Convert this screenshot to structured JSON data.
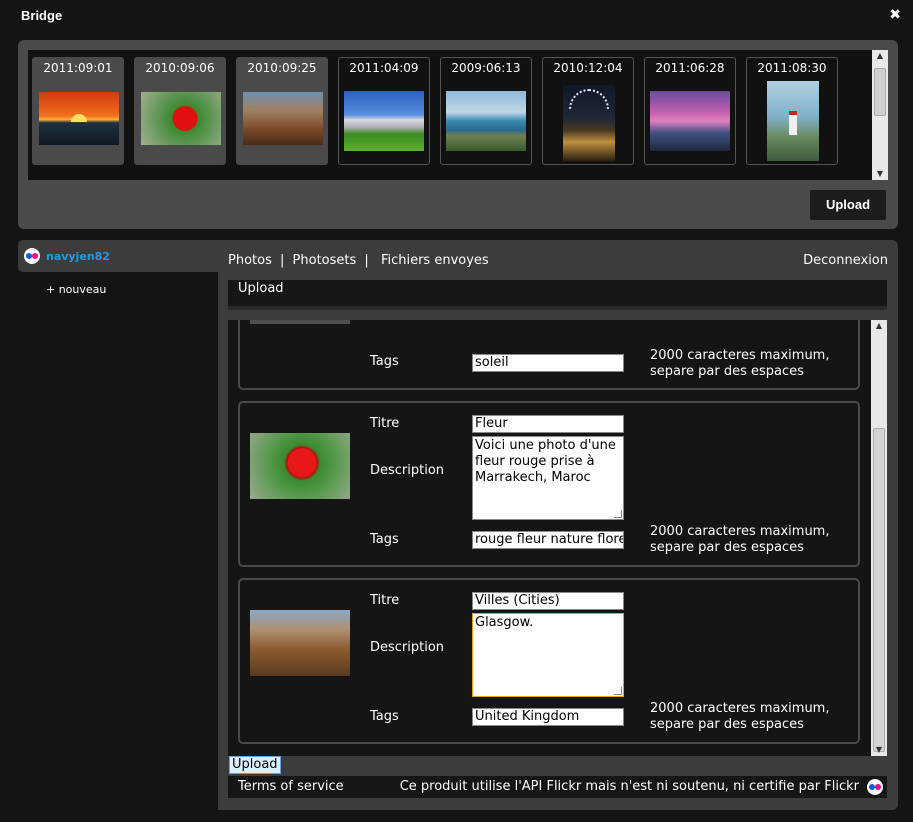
{
  "window": {
    "title": "Bridge",
    "close_glyph": "✖"
  },
  "strip": {
    "thumbnails": [
      {
        "date": "2011:09:01",
        "icon": "sunset-photo"
      },
      {
        "date": "2010:09:06",
        "icon": "red-flower-photo"
      },
      {
        "date": "2010:09:25",
        "icon": "buildings-photo"
      },
      {
        "date": "2011:04:09",
        "icon": "chateau-photo"
      },
      {
        "date": "2009:06:13",
        "icon": "coast-photo"
      },
      {
        "date": "2010:12:04",
        "icon": "night-building-photo"
      },
      {
        "date": "2011:06:28",
        "icon": "pink-sky-photo"
      },
      {
        "date": "2011:08:30",
        "icon": "lighthouse-photo"
      }
    ],
    "upload_label": "Upload"
  },
  "sidebar": {
    "username": "navyjen82",
    "new_label": "+ nouveau"
  },
  "nav": {
    "photos": "Photos",
    "sep1": "|",
    "photosets": "Photosets",
    "sep2": "|",
    "sent": "Fichiers envoyes",
    "logout": "Deconnexion"
  },
  "upload_header": "Upload",
  "cards": [
    {
      "tags_label": "Tags",
      "tags": "soleil",
      "hint_line1": "2000 caracteres maximum,",
      "hint_line2": "separe par des espaces"
    },
    {
      "title_label": "Titre",
      "title": "Fleur",
      "desc_label": "Description",
      "description": "Voici une photo d'une fleur rouge prise à Marrakech, Maroc",
      "tags_label": "Tags",
      "tags": "rouge fleur nature flore",
      "hint_line1": "2000 caracteres maximum,",
      "hint_line2": "separe par des espaces"
    },
    {
      "title_label": "Titre",
      "title": "Villes (Cities)",
      "desc_label": "Description",
      "description": "Glasgow.",
      "tags_label": "Tags",
      "tags": "United Kingdom",
      "hint_line1": "2000 caracteres maximum,",
      "hint_line2": "separe par des espaces"
    }
  ],
  "bottom_upload": "Upload",
  "footer": {
    "tos": "Terms of service",
    "note": "Ce produit utilise l'API Flickr mais n'est ni soutenu, ni certifie par Flickr"
  },
  "colors": {
    "username": "#1e9be8",
    "focus_border": "#e0a020",
    "flickr_blue": "#0063dc",
    "flickr_pink": "#ff0084"
  }
}
